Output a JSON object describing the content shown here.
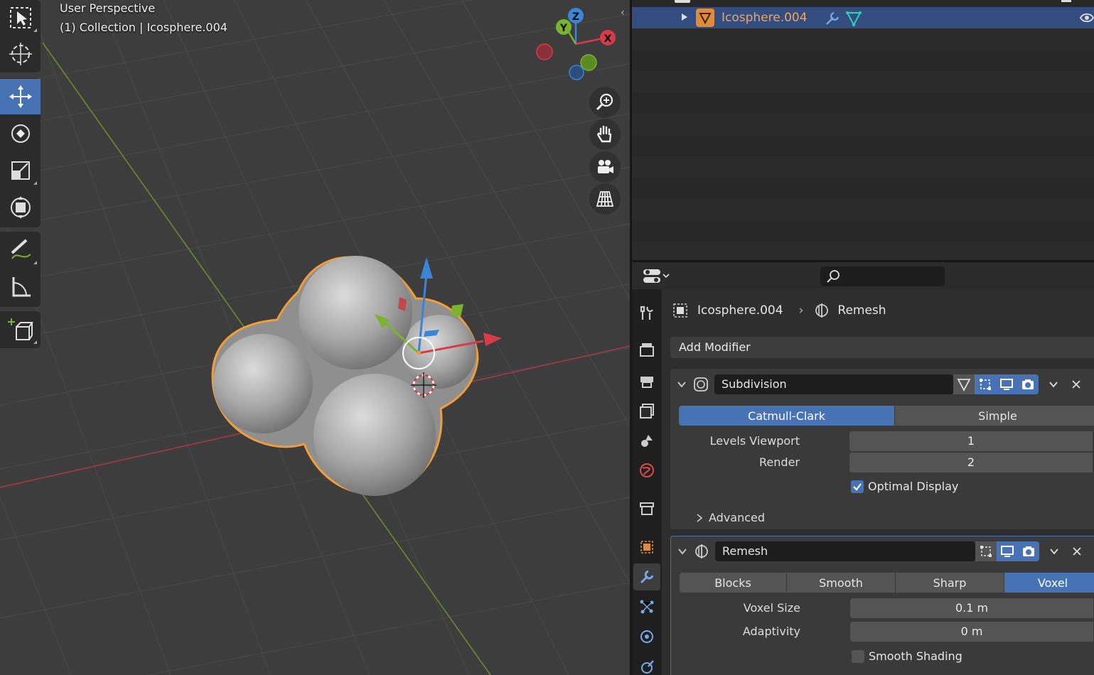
{
  "viewport": {
    "perspective_label": "User Perspective",
    "collection_label": "(1) Collection | Icosphere.004",
    "gizmo_axes": {
      "x": "X",
      "y": "Y",
      "z": "Z"
    }
  },
  "toolbar": {
    "tools": [
      {
        "name": "select-box-icon",
        "active": false
      },
      {
        "name": "cursor-icon",
        "active": false
      },
      {
        "name": "move-icon",
        "active": true
      },
      {
        "name": "rotate-icon",
        "active": false
      },
      {
        "name": "scale-icon",
        "active": false
      },
      {
        "name": "transform-icon",
        "active": false
      },
      {
        "name": "annotate-icon",
        "active": false
      },
      {
        "name": "measure-icon",
        "active": false
      },
      {
        "name": "add-cube-icon",
        "active": false
      }
    ]
  },
  "nav_buttons": [
    "zoom-icon",
    "pan-hand-icon",
    "camera-icon",
    "grid-icon"
  ],
  "outliner": {
    "selected_object": "Icosphere.004"
  },
  "properties": {
    "breadcrumb": {
      "object": "Icosphere.004",
      "modifier": "Remesh"
    },
    "add_modifier_label": "Add Modifier",
    "subdivision": {
      "name": "Subdivision",
      "modes": [
        "Catmull-Clark",
        "Simple"
      ],
      "active_mode": "Catmull-Clark",
      "levels_viewport_label": "Levels Viewport",
      "levels_viewport_value": "1",
      "render_label": "Render",
      "render_value": "2",
      "optimal_display_label": "Optimal Display",
      "optimal_display": true,
      "advanced_label": "Advanced"
    },
    "remesh": {
      "name": "Remesh",
      "modes": [
        "Blocks",
        "Smooth",
        "Sharp",
        "Voxel"
      ],
      "active_mode": "Voxel",
      "voxel_size_label": "Voxel Size",
      "voxel_size_value": "0.1 m",
      "adaptivity_label": "Adaptivity",
      "adaptivity_value": "0 m",
      "smooth_shading_label": "Smooth Shading",
      "smooth_shading": false
    }
  },
  "colors": {
    "accent": "#4772b3",
    "selection_outline": "#f29d38",
    "x_axis": "#d83a4a",
    "y_axis": "#7ab32e",
    "z_axis": "#3b84d8"
  }
}
